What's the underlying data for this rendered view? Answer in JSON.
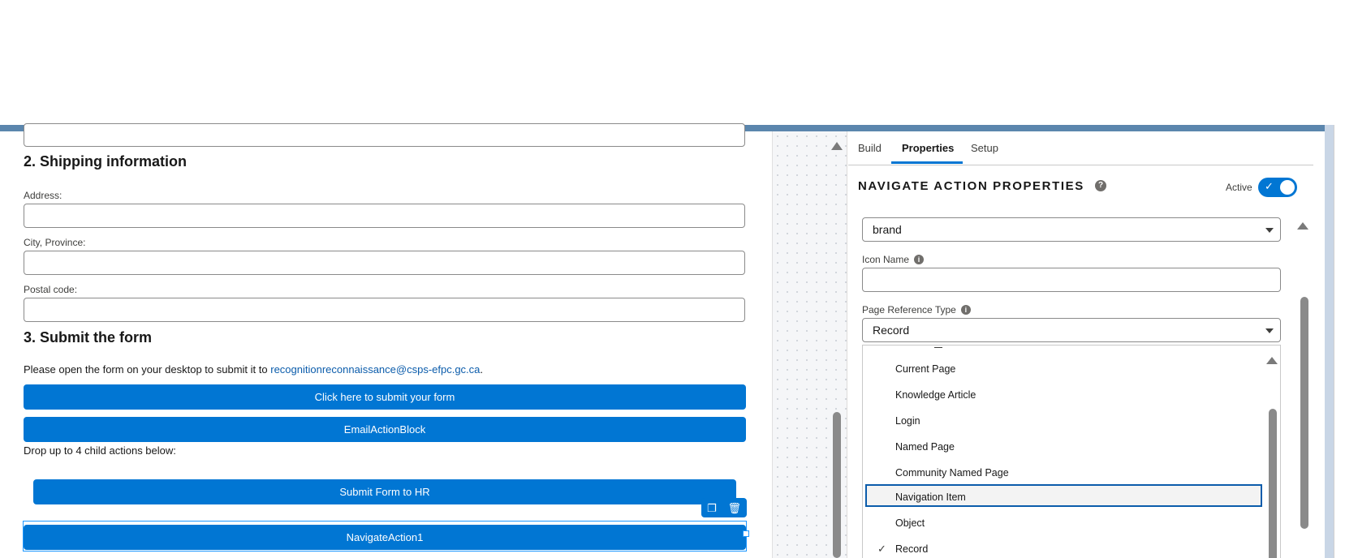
{
  "canvas": {
    "sections": {
      "shipping_title": "2. Shipping information",
      "submit_title": "3. Submit the form"
    },
    "fields": {
      "address_label": "Address:",
      "city_label": "City, Province:",
      "postal_label": "Postal code:"
    },
    "submit_text_prefix": "Please open the form on your desktop to submit it to ",
    "submit_email": "recognitionreconnaissance@csps-efpc.gc.ca",
    "submit_text_suffix": ".",
    "buttons": {
      "submit_form": "Click here to submit your form",
      "email_action": "EmailActionBlock",
      "submit_hr": "Submit Form to HR",
      "navigate_action": "NavigateAction1"
    },
    "drop_hint": "Drop up to 4 child actions below:"
  },
  "panel": {
    "tabs": [
      "Build",
      "Properties",
      "Setup"
    ],
    "active_tab": "Properties",
    "title": "NAVIGATE ACTION PROPERTIES",
    "active_label": "Active",
    "active": true,
    "button_variant_value": "brand",
    "icon_name_label": "Icon Name",
    "icon_name_value": "",
    "page_reference_type_label": "Page Reference Type",
    "page_reference_type_value": "Record",
    "dropdown_options": [
      "Current Page",
      "Knowledge Article",
      "Login",
      "Named Page",
      "Community Named Page",
      "Navigation Item",
      "Object",
      "Record"
    ],
    "highlighted_option": "Navigation Item",
    "selected_option": "Record"
  },
  "colors": {
    "brand_blue": "#0176d3",
    "header_strip": "#5b86ad",
    "link": "#0b5cab"
  }
}
